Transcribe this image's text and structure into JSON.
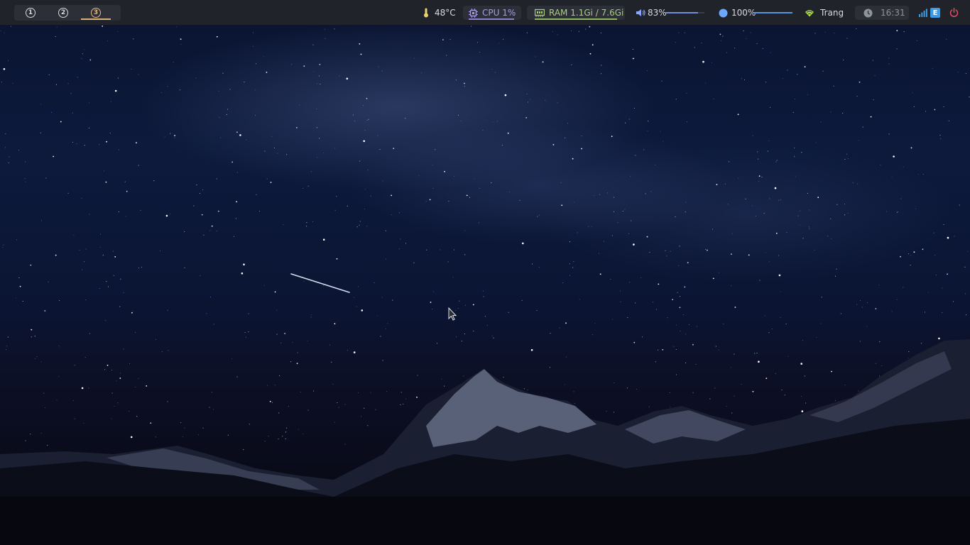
{
  "workspaces": [
    {
      "label": "1",
      "active": false
    },
    {
      "label": "2",
      "active": false
    },
    {
      "label": "3",
      "active": true
    }
  ],
  "status": {
    "temperature": "48°C",
    "cpu": "CPU 1%",
    "ram": "RAM 1.1Gi / 7.6Gi",
    "volume": "83%",
    "volume_level": 0.83,
    "brightness": "100%",
    "brightness_level": 1.0,
    "wifi": "Trang",
    "clock": "16:31",
    "tray_badge": "E"
  },
  "icons": {
    "temperature": "thermometer-icon",
    "cpu": "cpu-chip-icon",
    "ram": "memory-icon",
    "volume": "speaker-icon",
    "brightness": "brightness-icon",
    "wifi": "wifi-icon",
    "clock": "clock-icon",
    "signal": "signal-bars-icon",
    "power": "power-icon"
  },
  "colors": {
    "bar_bg": "#21232b",
    "temp": "#e9d26a",
    "cpu": "#a89be0",
    "ram": "#a9cf7a",
    "volume": "#8aa6ff",
    "brightness": "#6aa9ff",
    "wifi": "#b4e34a",
    "clock": "#8f939c",
    "power": "#e05060",
    "active_workspace": "#e5b981"
  }
}
